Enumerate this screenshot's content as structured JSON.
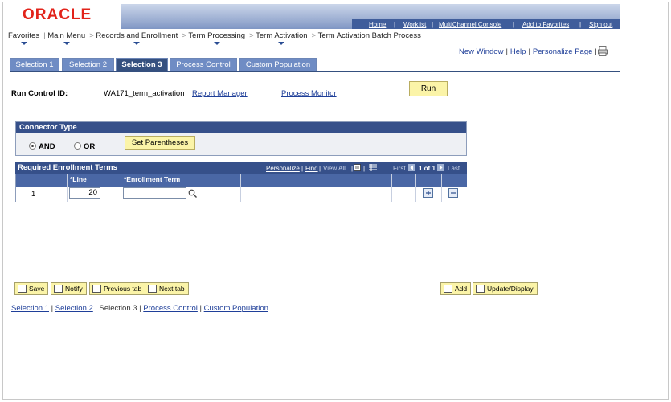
{
  "header": {
    "logo": "ORACLE",
    "links": [
      "Home",
      "Worklist",
      "MultiChannel Console",
      "Add to Favorites",
      "Sign out"
    ]
  },
  "breadcrumb": {
    "items": [
      "Favorites",
      "Main Menu",
      "Records and Enrollment",
      "Term Processing",
      "Term Activation",
      "Term Activation Batch Process"
    ]
  },
  "help_links": {
    "new_window": "New Window",
    "help": "Help",
    "personalize": "Personalize Page"
  },
  "tabs": [
    {
      "label": "Selection 1",
      "active": false
    },
    {
      "label": "Selection 2",
      "active": false
    },
    {
      "label": "Selection 3",
      "active": true
    },
    {
      "label": "Process Control",
      "active": false
    },
    {
      "label": "Custom Population",
      "active": false
    }
  ],
  "run_control": {
    "label": "Run Control ID:",
    "value": "WA171_term_activation",
    "report_manager": "Report Manager",
    "process_monitor": "Process Monitor",
    "run_label": "Run"
  },
  "connector": {
    "title": "Connector Type",
    "and_label": "AND",
    "or_label": "OR",
    "selected": "AND",
    "set_parentheses": "Set Parentheses"
  },
  "grid": {
    "title": "Required Enrollment Terms",
    "tools": {
      "personalize": "Personalize",
      "find": "Find",
      "view_all": "View All",
      "first": "First",
      "count": "1 of 1",
      "last": "Last"
    },
    "columns": [
      "*Line",
      "*Enrollment Term"
    ],
    "rows": [
      {
        "row_num": "1",
        "line": "20",
        "enrollment_term": ""
      }
    ]
  },
  "buttons": {
    "save": "Save",
    "notify": "Notify",
    "previous_tab": "Previous tab",
    "next_tab": "Next tab",
    "add": "Add",
    "update_display": "Update/Display"
  },
  "footer_links": [
    "Selection 1",
    "Selection 2",
    "Selection 3",
    "Process Control",
    "Custom Population"
  ],
  "colors": {
    "oracle_red": "#e2231a",
    "header_blue": "#36508a",
    "tab_active": "#35507f",
    "button_yellow": "#fbf4a8",
    "link_blue": "#1f3f99"
  }
}
